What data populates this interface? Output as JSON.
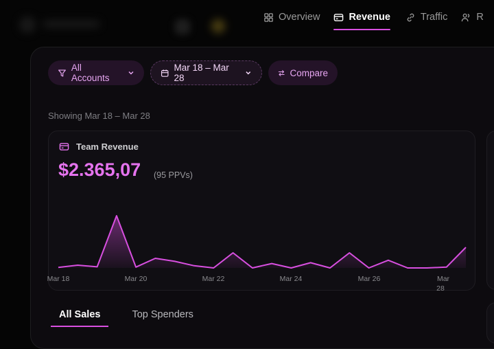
{
  "nav": {
    "tabs": [
      {
        "label": "Overview",
        "icon": "grid-icon",
        "active": false
      },
      {
        "label": "Revenue",
        "icon": "card-icon",
        "active": true
      },
      {
        "label": "Traffic",
        "icon": "link-icon",
        "active": false
      },
      {
        "label": "R",
        "icon": "users-icon",
        "active": false
      }
    ]
  },
  "filters": {
    "accounts_label": "All Accounts",
    "date_range_label": "Mar 18 – Mar 28",
    "compare_label": "Compare"
  },
  "showing_text": "Showing Mar 18 – Mar 28",
  "revenue_card": {
    "title": "Team Revenue",
    "amount": "$2.365,07",
    "ppv_text": "(95 PPVs)"
  },
  "colors": {
    "accent": "#e573ee",
    "line": "#d84fe0"
  },
  "chart_data": {
    "type": "area",
    "x": [
      "Mar 18",
      "",
      "",
      "",
      "Mar 20",
      "",
      "",
      "",
      "Mar 22",
      "",
      "",
      "",
      "Mar 24",
      "",
      "",
      "",
      "Mar 26",
      "",
      "",
      "",
      "Mar 28"
    ],
    "values": [
      2,
      10,
      4,
      190,
      3,
      35,
      24,
      8,
      0,
      55,
      0,
      16,
      0,
      19,
      0,
      55,
      0,
      28,
      0,
      0,
      3,
      75
    ],
    "tick_labels": [
      "Mar 18",
      "Mar 20",
      "Mar 22",
      "Mar 24",
      "Mar 26",
      "Mar 28"
    ],
    "title": "",
    "xlabel": "",
    "ylabel": "",
    "grid": false,
    "legend": "none"
  },
  "sales_tabs": [
    {
      "label": "All Sales",
      "active": true
    },
    {
      "label": "Top Spenders",
      "active": false
    }
  ]
}
